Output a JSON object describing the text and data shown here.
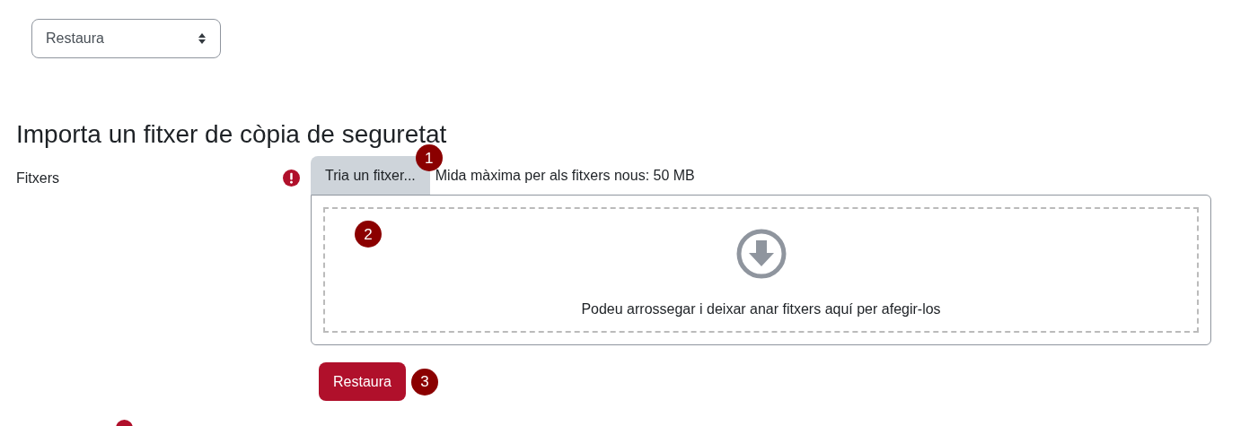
{
  "action_select": {
    "value": "Restaura"
  },
  "heading": "Importa un fitxer de còpia de seguretat",
  "files_field": {
    "label": "Fitxers",
    "required": true,
    "choose_button": "Tria un fitxer...",
    "max_size": "Mida màxima per als fitxers nous: 50 MB",
    "drop_hint": "Podeu arrossegar i deixar anar fitxers aquí per afegir-los"
  },
  "submit_button": "Restaura",
  "callouts": [
    "1",
    "2",
    "3"
  ]
}
